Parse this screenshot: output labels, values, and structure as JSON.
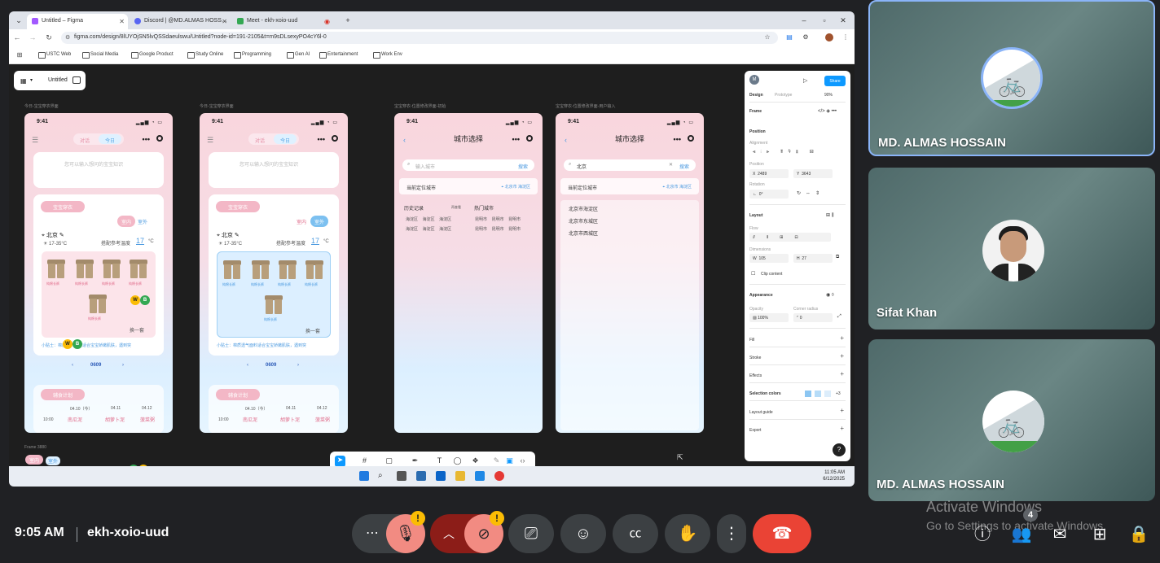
{
  "browser": {
    "tabs": [
      {
        "title": "Untitled – Figma",
        "active": true
      },
      {
        "title": "Discord | @MD.ALMAS HOSS…",
        "active": false
      },
      {
        "title": "Meet - ekh-xoio-uud",
        "active": false
      }
    ],
    "new_tab": "+",
    "url": "figma.com/design/8lUYOjSN5lvQSSdaeulswu/Untitled?node-id=191-2105&t=m9sDLsexyPO4cY6l-0",
    "bookmarks": [
      "USTC Web",
      "Social Media",
      "Google Product",
      "Study Online",
      "Programming",
      "Gen AI",
      "Entertainment",
      "Work Env"
    ]
  },
  "figma": {
    "file_name": "Untitled",
    "frames": [
      {
        "label": "今日-宝宝穿衣界面"
      },
      {
        "label": "今日-宝宝穿衣界面"
      },
      {
        "label": "宝宝穿衣-位置修改界面-初始"
      },
      {
        "label": "宝宝穿衣-位置修改界面-用户输入"
      }
    ],
    "phone": {
      "time": "9:41",
      "seg_dialog": "对话",
      "seg_today": "今日",
      "hint": "您可以输入想问的宝宝知识",
      "card_title": "宝宝穿衣",
      "indoor": "室内",
      "outdoor": "室外",
      "city": "北京",
      "temp_range": "17-35°C",
      "ref_temp_label": "搭配参考温度",
      "ref_temp": "17",
      "unit": "°C",
      "item_label": "纯棉长裤",
      "refresh": "换一套",
      "tip": "小贴士：棉质透气面料适合宝宝娇嫩肌肤，遇到突",
      "date": "0609",
      "plan_title": "辅食计划",
      "meal_dates": [
        "04.10（今）",
        "04.11",
        "04.12"
      ],
      "meal_time": "10:00",
      "meals": [
        "南瓜泥",
        "胡萝卜泥",
        "菠菜粥"
      ]
    },
    "city_select": {
      "title": "城市选择",
      "search_placeholder": "输入城市",
      "search_go": "搜索",
      "typed": "北京",
      "current_label": "当前定位城市",
      "current_city": "北京市 海淀区",
      "history_label": "历史记录",
      "clear_label": "再查看",
      "hot_label": "热门城市",
      "history": [
        "海淀区",
        "海淀区",
        "海淀区",
        "海淀区",
        "海淀区",
        "海淀区"
      ],
      "hot": [
        "昆明市",
        "昆明市",
        "昆明市",
        "昆明市",
        "昆明市",
        "昆明市"
      ],
      "results": [
        "北京市海淀区",
        "北京市东城区",
        "北京市西城区"
      ]
    },
    "frame_3880": "Frame 3880",
    "chips": [
      "W",
      "B"
    ],
    "panel": {
      "tabs": [
        "Design",
        "Prototype"
      ],
      "zoom": "90%",
      "share": "Share",
      "avatar": "M",
      "frame": "Frame",
      "position": "Position",
      "alignment": "Alignment",
      "pos_label": "Position",
      "x": "2489",
      "y": "3643",
      "rotation_label": "Rotation",
      "rotation": "0°",
      "layout": "Layout",
      "flow": "Flow",
      "dimensions": "Dimensions",
      "w": "105",
      "h": "27",
      "clip": "Clip content",
      "appearance": "Appearance",
      "opacity_label": "Opacity",
      "opacity": "100%",
      "radius_label": "Corner radius",
      "radius": "0",
      "sections": [
        "Fill",
        "Stroke",
        "Effects"
      ],
      "selection_colors": "Selection colors",
      "sel_more": "+3",
      "layout_guide": "Layout guide",
      "export": "Export",
      "help": "?"
    }
  },
  "taskbar": {
    "time": "11:05 AM",
    "date": "6/12/2025"
  },
  "participants": [
    {
      "name": "MD. ALMAS HOSSAIN",
      "speaking": true
    },
    {
      "name": "Sifat Khan"
    },
    {
      "name": "MD. ALMAS HOSSAIN"
    }
  ],
  "watermark": {
    "line1": "Activate Windows",
    "line2": "Go to Settings to activate Windows."
  },
  "meet": {
    "time": "9:05 AM",
    "code": "ekh-xoio-uud",
    "participant_count": "4",
    "warn": "!"
  },
  "colors": {
    "accent": "#0d99ff",
    "leave": "#ea4335",
    "warn": "#fbbc04",
    "muted_bg": "#f28b82"
  }
}
